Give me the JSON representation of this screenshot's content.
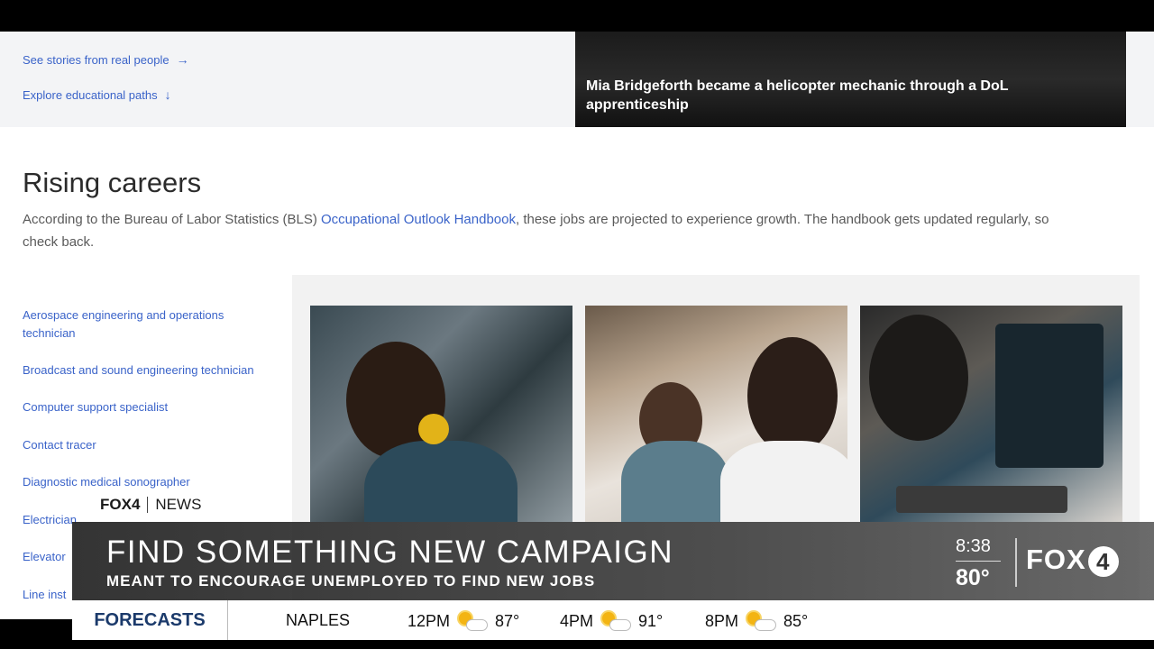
{
  "hero": {
    "links": [
      {
        "label": "See stories from real people",
        "arrow": "→"
      },
      {
        "label": "Explore educational paths",
        "arrow": "↓"
      }
    ],
    "story_caption": "Mia Bridgeforth became a helicopter mechanic through a DoL apprenticeship"
  },
  "rising_careers": {
    "title": "Rising careers",
    "desc_before": "According to the Bureau of Labor Statistics (BLS) ",
    "desc_link": "Occupational Outlook Handbook",
    "desc_after": ", these jobs are projected to experience growth. The handbook gets updated regularly, so check back.",
    "careers": [
      "Aerospace engineering and operations technician",
      "Broadcast and sound engineering technician",
      "Computer support specialist",
      "Contact tracer",
      "Diagnostic medical sonographer",
      "Electrician",
      "Elevator",
      "Line inst"
    ]
  },
  "news": {
    "network": "FOX4",
    "section": "NEWS",
    "headline": "FIND SOMETHING NEW CAMPAIGN",
    "subheadline": "MEANT TO ENCOURAGE UNEMPLOYED TO FIND NEW JOBS",
    "time": "8:38",
    "temperature": "80°",
    "logo_text": "FOX",
    "logo_number": "4"
  },
  "ticker": {
    "label": "FORECASTS",
    "city": "NAPLES",
    "forecasts": [
      {
        "time": "12PM",
        "icon": "partly-sunny-icon",
        "temp": "87°"
      },
      {
        "time": "4PM",
        "icon": "partly-sunny-icon",
        "temp": "91°"
      },
      {
        "time": "8PM",
        "icon": "partly-sunny-icon",
        "temp": "85°"
      }
    ]
  },
  "colors": {
    "link": "#3a63c9",
    "forecast_label": "#1b3a6b",
    "sun": "#f3b413"
  }
}
